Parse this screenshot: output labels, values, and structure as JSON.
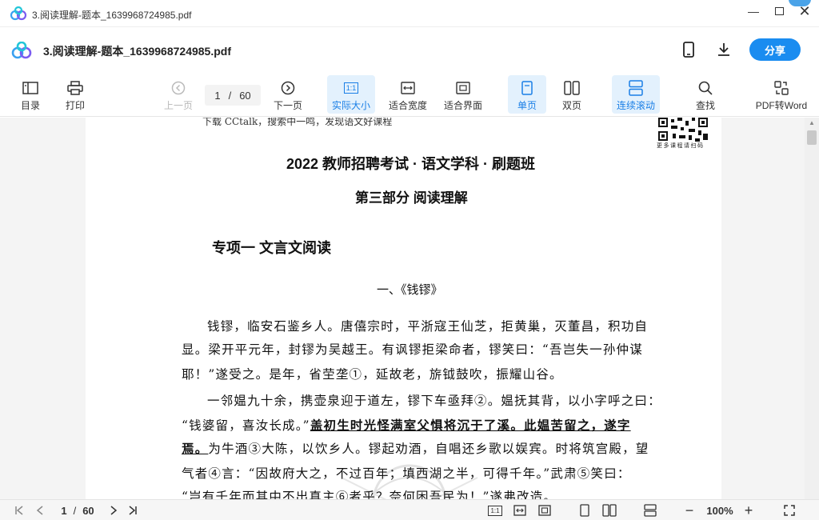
{
  "window": {
    "title": "3.阅读理解-题本_1639968724985.pdf"
  },
  "header": {
    "doc_name": "3.阅读理解-题本_1639968724985.pdf",
    "share_label": "分享"
  },
  "toolbar": {
    "contents": "目录",
    "print": "打印",
    "prev": "上一页",
    "next": "下一页",
    "page_current": "1",
    "page_sep": "/",
    "page_total": "60",
    "actual_size": "实际大小",
    "actual_size_icon": "1:1",
    "fit_width": "适合宽度",
    "fit_page": "适合界面",
    "single": "单页",
    "double": "双页",
    "continuous": "连续滚动",
    "find": "查找",
    "pdf2word": "PDF转Word"
  },
  "document": {
    "top_note": "下载 CCtalk，搜索中一鸣，发现语文好课程",
    "qr_caption": "更多课程请扫码",
    "title": "2022 教师招聘考试 · 语文学科 · 刷题班",
    "part": "第三部分  阅读理解",
    "section": "专项一  文言文阅读",
    "subsection": "一、《钱镠》",
    "p1": [
      "钱镠，临安石鉴乡人。唐僖宗时，平浙寇王仙芝，拒黄巢，灭董昌，积功自",
      "显。梁开平元年，封镠为吴越王。有讽镠拒梁命者，镠笑曰：“吾岂失一孙仲谋",
      "耶！”遂受之。是年，省茔垄①，延故老，旂钺鼓吹，振耀山谷。"
    ],
    "p2_l1": "一邻媪九十余，携壶泉迎于道左，镠下车亟拜②。媪抚其背，以小字呼之曰：",
    "p2_l2a": "“钱婆留，喜汝长成。”",
    "p2_l2b": "盖初生时光怪满室父惧将沉于了溪。此媪苦留之，遂字",
    "p2_l3a": "焉。",
    "p2_l3b": "为牛酒③大陈，以饮乡人。镠起劝酒，自唱还乡歌以娱宾。时将筑宫殿，望",
    "p2_l4": "气者④言：“因故府大之，不过百年；填西湖之半，可得千年。”武肃⑤笑曰：",
    "p2_l5": "“岂有千年而其中不出真主⑥者乎？奈何困吾民为！”遂弗改造。"
  },
  "status": {
    "page_current": "1",
    "page_sep": "/",
    "page_total": "60",
    "zoom": "100%",
    "one_to_one": "1:1"
  }
}
